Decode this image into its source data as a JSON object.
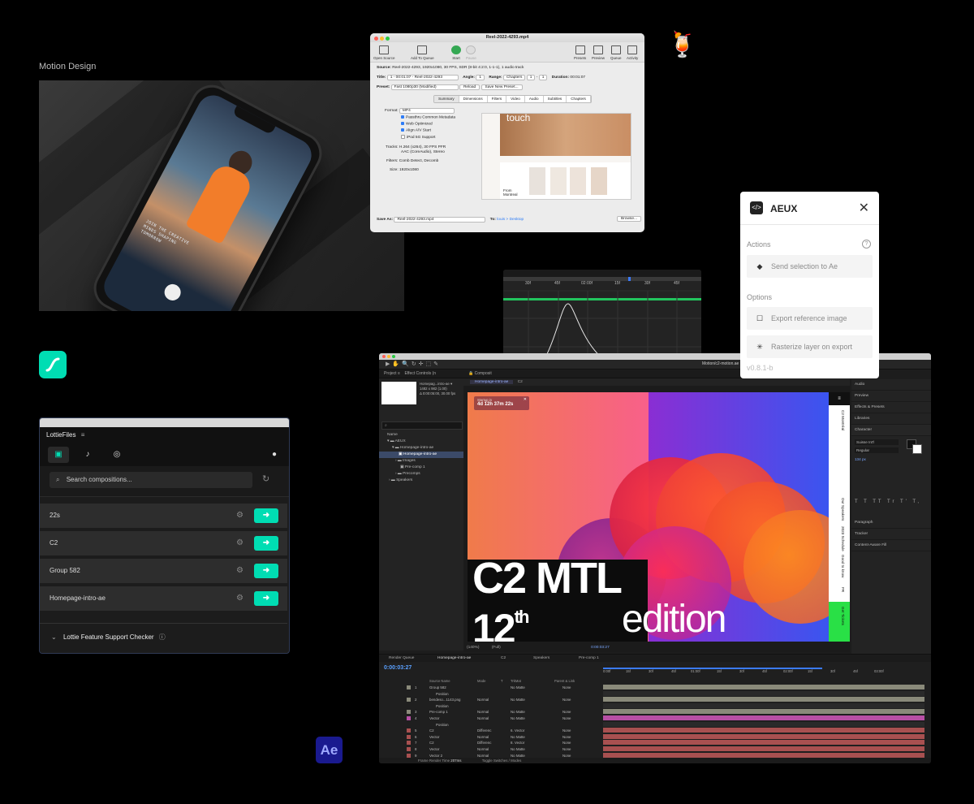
{
  "section_label": "Motion Design",
  "phone": {
    "text_lines": [
      "JOIN THE CREATIVE",
      "MINDS SHAPING",
      "TOMORROW"
    ]
  },
  "handbrake": {
    "window_title": "Reel-2022-4293.mp4",
    "toolbar": [
      "Open Source",
      "Add To Queue",
      "Start",
      "Pause",
      "Presets",
      "Preview",
      "Queue",
      "Activity"
    ],
    "source_label": "Source:",
    "source_value": "Reel-2022-4293, 1920x1080, 30 FPS, SDR (8-bit 4:2:0, 1-1-1), 1 audio track",
    "title_label": "Title:",
    "title_value": "1 - 00:01:07 - Reel-2022-4293",
    "angle_label": "Angle:",
    "angle_value": "1",
    "range_label": "Range:",
    "range_value": "Chapters",
    "range_from": "1",
    "range_to": "1",
    "duration_label": "Duration:",
    "duration_value": "00:01:07",
    "preset_label": "Preset:",
    "preset_value": "Fast 1080p30 (Modified)",
    "reload": "Reload",
    "save_preset": "Save New Preset...",
    "tabs": [
      "Summary",
      "Dimensions",
      "Filters",
      "Video",
      "Audio",
      "Subtitles",
      "Chapters"
    ],
    "format_label": "Format:",
    "format_value": "MP4",
    "options": [
      {
        "label": "Passthru Common Metadata",
        "checked": true
      },
      {
        "label": "Web Optimized",
        "checked": true
      },
      {
        "label": "Align A/V Start",
        "checked": true
      },
      {
        "label": "iPod 5G Support",
        "checked": false
      }
    ],
    "tracks_label": "Tracks:",
    "tracks_value_1": "H.264 (x264), 30 FPS PFR",
    "tracks_value_2": "AAC (CoreAudio), Stereo",
    "filters_label": "Filters:",
    "filters_value": "Comb Detect, Decomb",
    "size_label": "Size:",
    "size_value": "1920x1080",
    "preview_word": "touch",
    "preview_caption": "From Montreal",
    "save_as_label": "Save As:",
    "save_as_value": "Reel-2022-4293.mp4",
    "to_label": "To:",
    "to_value": "louis > Desktop",
    "browse": "Browse..."
  },
  "graph_editor": {
    "ticks": [
      "30f",
      "45f",
      "02:00f",
      "15f",
      "30f",
      "45f"
    ]
  },
  "aeux": {
    "title": "AEUX",
    "actions_label": "Actions",
    "send_selection": "Send selection to Ae",
    "options_label": "Options",
    "export_reference": "Export reference image",
    "rasterize": "Rasterize layer on export",
    "version": "v0.8.1-b"
  },
  "lottiefiles": {
    "app_name": "LottieFiles",
    "search_placeholder": "Search compositions...",
    "items": [
      "22s",
      "C2",
      "Group 582",
      "Homepage-intro-ae"
    ],
    "feature_checker": "Lottie Feature Support Checker"
  },
  "ae_badge": "Ae",
  "after_effects": {
    "window_title": "Motion/c2-motion.ae",
    "project_tab": "Project",
    "effect_controls": "Effect Controls (n",
    "comp_tab": "Composit",
    "comp_name": "Homepage-intro-ae",
    "comp_tab_2": "C2",
    "thumb_info": [
      "Homepag...intro-ae ▾",
      "1482 x 982 (1.00)",
      "Δ 0:00:05:00, 30.00 fps"
    ],
    "project_tree": [
      {
        "label": "Name",
        "sel": false
      },
      {
        "label": "AEUX",
        "sel": false
      },
      {
        "label": "Homepage-intro-ae",
        "sel": false
      },
      {
        "label": "Homepage-intro-ae",
        "sel": true
      },
      {
        "label": "Images",
        "sel": false
      },
      {
        "label": "Pre-comp 1",
        "sel": false
      },
      {
        "label": "Precomps",
        "sel": false
      },
      {
        "label": "Speakers",
        "sel": false
      }
    ],
    "startup_label": "Startup in",
    "countdown": "4d  12h  37m  22s",
    "art_line1": "C2 MTL",
    "art_line2": "12",
    "art_sup": "th",
    "art_line3": "edition",
    "side_nav": [
      "C2 Montréal",
      "Our Speakers",
      "2023 Schedule",
      "Good to know",
      "FR",
      "Get Tickets"
    ],
    "view_zoom": "(140%)",
    "view_res": "(Full)",
    "view_time": "0:00:03:27",
    "right_panel": [
      "Audio",
      "Preview",
      "Effects & Presets",
      "Libraries",
      "Character",
      "Paragraph",
      "Tracker",
      "Content-Aware Fill"
    ],
    "font_name": "Suisse Int'l",
    "font_style": "Regular",
    "font_size": "134 px",
    "timeline_tabs": [
      "Render Queue",
      "Homepage-intro-ae",
      "C2",
      "Speakers",
      "Pre-comp 1"
    ],
    "timecode": "0:00:03:27",
    "layer_header": [
      "Source Name",
      "Mode",
      "T",
      "TrkMat",
      "Parent & Link"
    ],
    "layers": [
      {
        "num": "1",
        "name": "Group 582",
        "mode": "",
        "matte": "No Matte",
        "parent": "None",
        "color": "#8a8a7a"
      },
      {
        "num": "",
        "name": "Position",
        "mode": "",
        "matte": "",
        "parent": "",
        "color": ""
      },
      {
        "num": "2",
        "name": "bendeso...1143.png",
        "mode": "Normal",
        "matte": "No Matte",
        "parent": "None",
        "color": "#8a8a7a"
      },
      {
        "num": "",
        "name": "Position",
        "mode": "",
        "matte": "",
        "parent": "",
        "color": ""
      },
      {
        "num": "3",
        "name": "Pre-comp 1",
        "mode": "Normal",
        "matte": "No Matte",
        "parent": "None",
        "color": "#8a8a7a"
      },
      {
        "num": "4",
        "name": "Vector",
        "mode": "Normal",
        "matte": "No Matte",
        "parent": "None",
        "color": "#b84fa5"
      },
      {
        "num": "",
        "name": "Position",
        "mode": "",
        "matte": "",
        "parent": "",
        "color": ""
      },
      {
        "num": "5",
        "name": "C2",
        "mode": "Differenc",
        "matte": "6. Vector",
        "parent": "None",
        "color": "#a85050"
      },
      {
        "num": "6",
        "name": "Vector",
        "mode": "Normal",
        "matte": "No Matte",
        "parent": "None",
        "color": "#a85050"
      },
      {
        "num": "7",
        "name": "C2",
        "mode": "Differenc",
        "matte": "8. Vector",
        "parent": "None",
        "color": "#a85050"
      },
      {
        "num": "8",
        "name": "Vector",
        "mode": "Normal",
        "matte": "No Matte",
        "parent": "None",
        "color": "#a85050"
      },
      {
        "num": "9",
        "name": "Vector 2",
        "mode": "Normal",
        "matte": "No Matte",
        "parent": "None",
        "color": "#a85050"
      }
    ],
    "ruler_ticks": [
      "0:00f",
      "15f",
      "30f",
      "45f",
      "01:00f",
      "15f",
      "30f",
      "45f",
      "02:00f",
      "15f",
      "30f",
      "45f",
      "03:00f"
    ],
    "footer_left": "Frame Render Time",
    "footer_time": "207ms",
    "footer_mid": "Toggle Switches / Modes"
  },
  "colors": {
    "lottie_green": "#00ddb3",
    "ae_blue": "#1a1a8f",
    "aeux_bg": "#ffffff"
  }
}
